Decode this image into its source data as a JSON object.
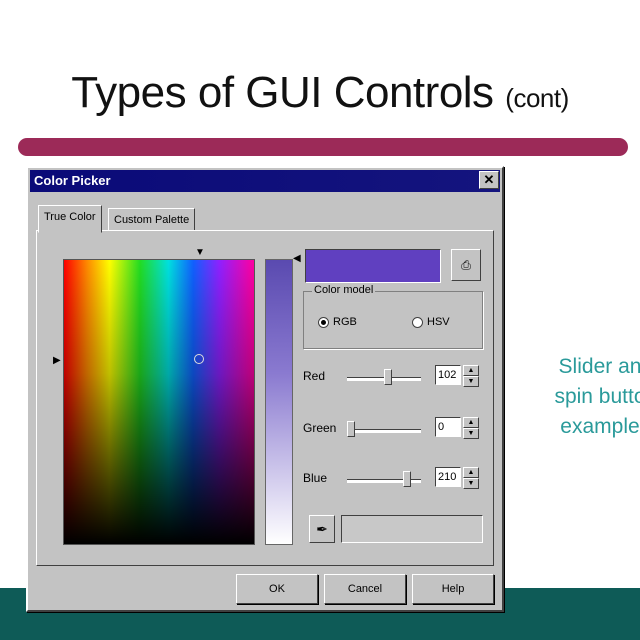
{
  "slide": {
    "title": "Types of GUI Controls",
    "title_suffix": "(cont)",
    "note_lines": [
      "Slider an",
      "spin butto",
      "example"
    ]
  },
  "dialog": {
    "title": "Color Picker",
    "close_glyph": "✕",
    "tabs": [
      {
        "label": "True Color",
        "active": true
      },
      {
        "label": "Custom Palette",
        "active": false
      }
    ],
    "current_color": "#6040c0",
    "color_model": {
      "label": "Color model",
      "options": [
        {
          "label": "RGB",
          "selected": true
        },
        {
          "label": "HSV",
          "selected": false
        }
      ]
    },
    "channels": [
      {
        "label": "Red",
        "value": "102",
        "level": 0.55
      },
      {
        "label": "Green",
        "value": "0",
        "level": 0.0
      },
      {
        "label": "Blue",
        "value": "210",
        "level": 0.82
      }
    ],
    "buttons": {
      "ok": "OK",
      "cancel": "Cancel",
      "help": "Help"
    }
  },
  "colors": {
    "accent_rule": "#9c2a58",
    "footer_band": "#0e5b57",
    "note_text": "#2a9a9a",
    "titlebar": "#0a0a78"
  }
}
